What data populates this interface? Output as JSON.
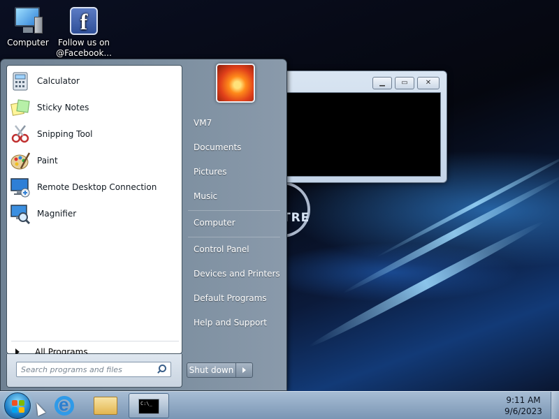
{
  "desktop": {
    "icons": [
      {
        "label": "Computer",
        "icon": "computer-icon"
      },
      {
        "label": "Follow us on @Facebook...",
        "icon": "facebook-icon"
      }
    ],
    "wallpaper_text": "TRE"
  },
  "console_window": {
    "minimize_glyph": "▁",
    "maximize_glyph": "▭",
    "close_glyph": "✕"
  },
  "start_menu": {
    "programs": [
      {
        "label": "Calculator",
        "icon": "calculator-icon"
      },
      {
        "label": "Sticky Notes",
        "icon": "sticky-notes-icon"
      },
      {
        "label": "Snipping Tool",
        "icon": "scissors-icon"
      },
      {
        "label": "Paint",
        "icon": "paint-palette-icon"
      },
      {
        "label": "Remote Desktop Connection",
        "icon": "remote-desktop-icon"
      },
      {
        "label": "Magnifier",
        "icon": "magnifier-icon"
      }
    ],
    "all_programs": "All Programs",
    "search_placeholder": "Search programs and files",
    "right_items": [
      {
        "label": "VM7"
      },
      {
        "label": "Documents"
      },
      {
        "label": "Pictures"
      },
      {
        "label": "Music"
      },
      {
        "label": "Computer"
      },
      {
        "label": "Control Panel"
      },
      {
        "label": "Devices and Printers"
      },
      {
        "label": "Default Programs"
      },
      {
        "label": "Help and Support"
      }
    ],
    "shutdown_label": "Shut down"
  },
  "taskbar": {
    "cmd_preview": "C:\\_",
    "time": "9:11 AM",
    "date": "9/6/2023"
  },
  "colors": {
    "taskbar": "#8fa9c4",
    "start_menu_right": "#7d8fa0",
    "accent": "#2f7fd6"
  }
}
